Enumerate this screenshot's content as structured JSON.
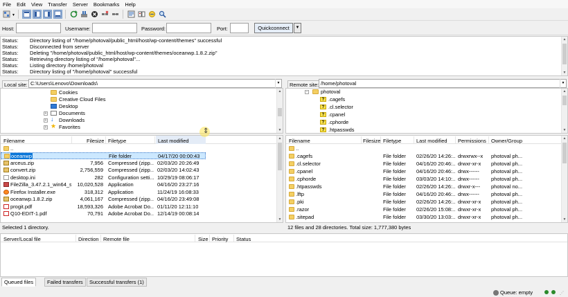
{
  "menu": [
    "File",
    "Edit",
    "View",
    "Transfer",
    "Server",
    "Bookmarks",
    "Help"
  ],
  "toolbar_icons": [
    {
      "name": "site-manager-icon"
    },
    {
      "name": "toggle-message-log-icon"
    },
    {
      "name": "toggle-local-tree-icon"
    },
    {
      "name": "toggle-remote-tree-icon"
    },
    {
      "name": "toggle-queue-icon"
    },
    {
      "name": "refresh-icon"
    },
    {
      "name": "process-queue-icon"
    },
    {
      "name": "cancel-icon"
    },
    {
      "name": "disconnect-icon"
    },
    {
      "name": "reconnect-icon"
    },
    {
      "name": "filter-icon"
    },
    {
      "name": "compare-icon"
    },
    {
      "name": "sync-browse-icon"
    },
    {
      "name": "search-icon"
    }
  ],
  "quickconnect": {
    "host_label": "Host:",
    "username_label": "Username:",
    "password_label": "Password:",
    "port_label": "Port:",
    "button": "Quickconnect",
    "dropdown_arrow": "▼"
  },
  "log": [
    {
      "k": "Status:",
      "m": "Directory listing of \"/home/photoval/public_html/host/wp-content/themes\" successful"
    },
    {
      "k": "Status:",
      "m": "Disconnected from server"
    },
    {
      "k": "Status:",
      "m": "Deleting \"/home/photoval/public_html/host/wp-content/themes/oceanwp.1.8.2.zip\""
    },
    {
      "k": "Status:",
      "m": "Retrieving directory listing of \"/home/photoval\"..."
    },
    {
      "k": "Status:",
      "m": "Listing directory /home/photoval"
    },
    {
      "k": "Status:",
      "m": "Directory listing of \"/home/photoval\" successful"
    }
  ],
  "local": {
    "label": "Local site:",
    "path": "C:\\Users\\Lenovo\\Downloads\\",
    "tree": [
      "Cookies",
      "Creative Cloud Files",
      "Desktop",
      "Documents",
      "Downloads",
      "Favorites"
    ],
    "headers": {
      "name": "Filename",
      "size": "Filesize",
      "type": "Filetype",
      "modified": "Last modified"
    },
    "files": [
      {
        "name": "..",
        "size": "",
        "type": "",
        "modified": "",
        "icon": "folder"
      },
      {
        "name": "oceanwp",
        "size": "",
        "type": "File folder",
        "modified": "04/17/20 00:00:43",
        "icon": "folder"
      },
      {
        "name": "arceus.zip",
        "size": "7,956",
        "type": "Compressed (zipp...",
        "modified": "02/03/20 20:26:49",
        "icon": "zip"
      },
      {
        "name": "convert.zip",
        "size": "2,756,559",
        "type": "Compressed (zipp...",
        "modified": "02/03/20 14:02:43",
        "icon": "zip"
      },
      {
        "name": "desktop.ini",
        "size": "282",
        "type": "Configuration setti...",
        "modified": "10/29/19 08:06:17",
        "icon": "file"
      },
      {
        "name": "FileZilla_3.47.2.1_win64_sp...",
        "size": "10,020,528",
        "type": "Application",
        "modified": "04/16/20 23:27:16",
        "icon": "exe"
      },
      {
        "name": "Firefox Installer.exe",
        "size": "318,312",
        "type": "Application",
        "modified": "11/24/19 16:08:33",
        "icon": "ff"
      },
      {
        "name": "oceanwp.1.8.2.zip",
        "size": "4,061,167",
        "type": "Compressed (zipp...",
        "modified": "04/16/20 23:49:08",
        "icon": "zip"
      },
      {
        "name": "progit.pdf",
        "size": "18,593,326",
        "type": "Adobe Acrobat Do...",
        "modified": "01/11/20 12:11:10",
        "icon": "pdf"
      },
      {
        "name": "Q10-EDIT-1.pdf",
        "size": "70,791",
        "type": "Adobe Acrobat Do...",
        "modified": "12/14/19 00:08:14",
        "icon": "pdf"
      }
    ],
    "status": "Selected 1 directory."
  },
  "remote": {
    "label": "Remote site:",
    "path": "/home/photoval",
    "tree": [
      "photoval",
      ".cagefs",
      ".cl.selector",
      ".cpanel",
      ".cphorde",
      ".htpasswds"
    ],
    "headers": {
      "name": "Filename",
      "size": "Filesize",
      "type": "Filetype",
      "modified": "Last modified",
      "perms": "Permissions",
      "owner": "Owner/Group"
    },
    "files": [
      {
        "name": "..",
        "size": "",
        "type": "",
        "modified": "",
        "perms": "",
        "owner": ""
      },
      {
        "name": ".cagefs",
        "size": "",
        "type": "File folder",
        "modified": "02/26/20 14:26:...",
        "perms": "drwxrwx--x",
        "owner": "photoval ph..."
      },
      {
        "name": ".cl.selector",
        "size": "",
        "type": "File folder",
        "modified": "04/16/20 20:46:...",
        "perms": "drwxr-xr-x",
        "owner": "photoval ph..."
      },
      {
        "name": ".cpanel",
        "size": "",
        "type": "File folder",
        "modified": "04/16/20 20:46:...",
        "perms": "drwx------",
        "owner": "photoval ph..."
      },
      {
        "name": ".cphorde",
        "size": "",
        "type": "File folder",
        "modified": "03/03/20 14:10:...",
        "perms": "drwx------",
        "owner": "photoval ph..."
      },
      {
        "name": ".htpasswds",
        "size": "",
        "type": "File folder",
        "modified": "02/26/20 14:26:...",
        "perms": "drwxr-x---",
        "owner": "photoval no..."
      },
      {
        "name": ".lftp",
        "size": "",
        "type": "File folder",
        "modified": "04/16/20 20:46:...",
        "perms": "drwx------",
        "owner": "photoval ph..."
      },
      {
        "name": ".pki",
        "size": "",
        "type": "File folder",
        "modified": "02/26/20 14:26:...",
        "perms": "drwxr-xr-x",
        "owner": "photoval ph..."
      },
      {
        "name": ".razor",
        "size": "",
        "type": "File folder",
        "modified": "02/26/20 15:08:...",
        "perms": "drwxr-xr-x",
        "owner": "photoval ph..."
      },
      {
        "name": ".sitepad",
        "size": "",
        "type": "File folder",
        "modified": "03/30/20 13:03:...",
        "perms": "drwxr-xr-x",
        "owner": "photoval ph..."
      }
    ],
    "status": "12 files and 28 directories. Total size: 1,777,380 bytes"
  },
  "queue": {
    "headers": {
      "server": "Server/Local file",
      "direction": "Direction",
      "remote": "Remote file",
      "size": "Size",
      "priority": "Priority",
      "status": "Status"
    },
    "tabs": [
      "Queued files",
      "Failed transfers",
      "Successful transfers (1)"
    ],
    "status": "Queue: empty"
  }
}
